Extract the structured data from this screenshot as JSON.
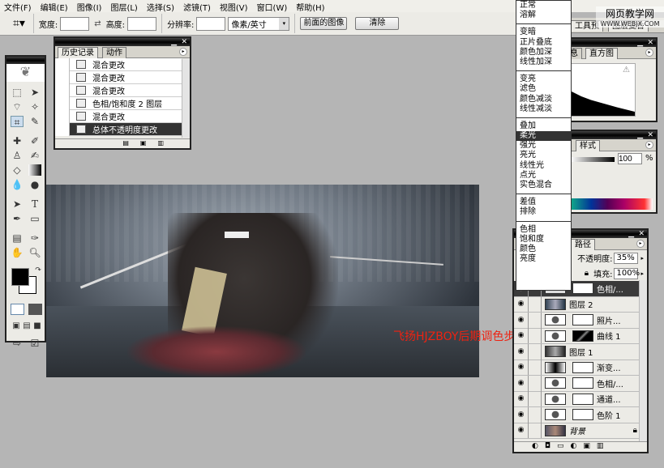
{
  "menu": [
    "文件(F)",
    "编辑(E)",
    "图像(I)",
    "图层(L)",
    "选择(S)",
    "滤镜(T)",
    "视图(V)",
    "窗口(W)",
    "帮助(H)"
  ],
  "options": {
    "width_label": "宽度:",
    "height_label": "高度:",
    "resolution_label": "分辨率:",
    "unit": "像素/英寸",
    "front_image": "前面的图像",
    "clear": "清除",
    "width_value": "",
    "height_value": "",
    "resolution_value": ""
  },
  "watermark": {
    "line1": "网页教学网",
    "line2": "WWW.WEBJX.COM"
  },
  "right_tabs": {
    "tool_presets": "工具预",
    "layer_comps": "图层复合"
  },
  "histogram": {
    "tab_info": "息",
    "tab_histogram": "直方图"
  },
  "styles": {
    "tab": "样式",
    "value": "100",
    "unit": "%"
  },
  "history": {
    "tabs": [
      "历史记录",
      "动作"
    ],
    "items": [
      "混合更改",
      "混合更改",
      "混合更改",
      "色相/饱和度 2 图层",
      "混合更改",
      "总体不透明度更改"
    ]
  },
  "blend_modes": [
    [
      "正常",
      "溶解"
    ],
    [
      "变暗",
      "正片叠底",
      "颜色加深",
      "线性加深"
    ],
    [
      "变亮",
      "滤色",
      "颜色减淡",
      "线性减淡"
    ],
    [
      "叠加",
      "柔光",
      "强光",
      "亮光",
      "线性光",
      "点光",
      "实色混合"
    ],
    [
      "差值",
      "排除"
    ],
    [
      "色相",
      "饱和度",
      "颜色",
      "亮度"
    ]
  ],
  "blend_selected": "柔光",
  "layers": {
    "tab_paths": "路径",
    "opacity_label": "不透明度:",
    "opacity": "35%",
    "fill_label": "填充:",
    "fill": "100%",
    "items": [
      {
        "name": "色相/...",
        "type": "adj",
        "selected": true
      },
      {
        "name": "图层 2",
        "type": "img"
      },
      {
        "name": "照片...",
        "type": "adj"
      },
      {
        "name": "曲线 1",
        "type": "curve"
      },
      {
        "name": "图层 1",
        "type": "img"
      },
      {
        "name": "渐变...",
        "type": "grad"
      },
      {
        "name": "色相/...",
        "type": "adj"
      },
      {
        "name": "通道...",
        "type": "adj"
      },
      {
        "name": "色阶 1",
        "type": "adj"
      },
      {
        "name": "背景",
        "type": "img",
        "locked": true
      }
    ]
  },
  "caption": "飞扬HJZBOY后期调色步骤"
}
